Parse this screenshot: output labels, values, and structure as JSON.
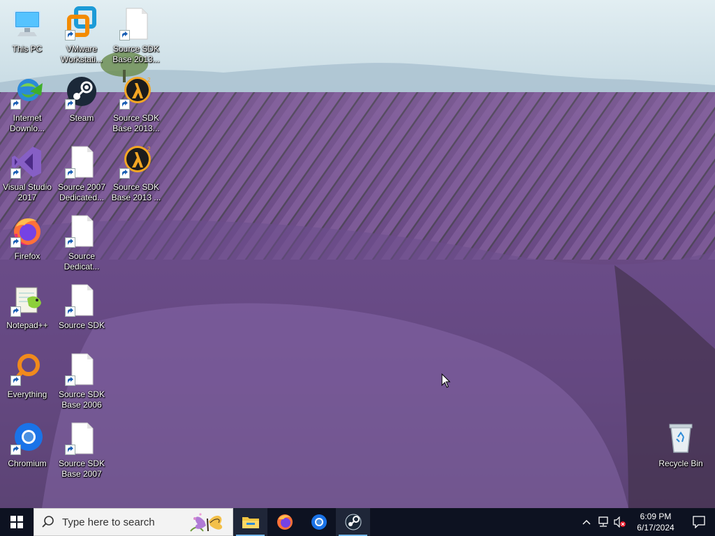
{
  "desktop": {
    "icons_left": [
      {
        "id": "this-pc",
        "label": "This PC",
        "icon": "this-pc-icon",
        "shortcut": false
      },
      {
        "id": "internet-download-manager",
        "label": "Internet\nDownlo...",
        "icon": "internet-download-manager-icon",
        "shortcut": true
      },
      {
        "id": "visual-studio-2017",
        "label": "Visual Studio\n2017",
        "icon": "visual-studio-icon",
        "shortcut": true
      },
      {
        "id": "firefox",
        "label": "Firefox",
        "icon": "firefox-icon",
        "shortcut": true
      },
      {
        "id": "notepad-plus-plus",
        "label": "Notepad++",
        "icon": "notepad-plus-plus-icon",
        "shortcut": true
      },
      {
        "id": "everything",
        "label": "Everything",
        "icon": "everything-icon",
        "shortcut": true
      },
      {
        "id": "chromium",
        "label": "Chromium",
        "icon": "chromium-icon",
        "shortcut": true
      }
    ],
    "icons_middle": [
      {
        "id": "vmware-workstation",
        "label": "VMware\nWorkstati...",
        "icon": "vmware-icon",
        "shortcut": true
      },
      {
        "id": "steam",
        "label": "Steam",
        "icon": "steam-icon",
        "shortcut": true
      },
      {
        "id": "source-2007-dedicated",
        "label": "Source 2007\nDedicated...",
        "icon": "blank-file-icon",
        "shortcut": true
      },
      {
        "id": "source-dedicated",
        "label": "Source\nDedicat...",
        "icon": "blank-file-icon",
        "shortcut": true
      },
      {
        "id": "source-sdk",
        "label": "Source SDK",
        "icon": "blank-file-icon",
        "shortcut": true
      },
      {
        "id": "source-sdk-base-2006",
        "label": "Source SDK\nBase 2006",
        "icon": "blank-file-icon",
        "shortcut": true
      },
      {
        "id": "source-sdk-base-2007",
        "label": "Source SDK\nBase 2007",
        "icon": "blank-file-icon",
        "shortcut": true
      }
    ],
    "icons_right": [
      {
        "id": "source-sdk-base-2013-a",
        "label": "Source SDK\nBase 2013...",
        "icon": "blank-file-icon",
        "shortcut": true
      },
      {
        "id": "source-sdk-base-2013-b",
        "label": "Source SDK\nBase 2013...",
        "icon": "half-life-2-icon",
        "shortcut": true
      },
      {
        "id": "source-sdk-base-2013-c",
        "label": "Source SDK\nBase 2013 ...",
        "icon": "half-life-2-icon",
        "shortcut": true
      }
    ],
    "recycle_bin": {
      "label": "Recycle Bin",
      "icon": "recycle-bin-icon"
    }
  },
  "taskbar": {
    "search_placeholder": "Type here to search",
    "apps": [
      {
        "id": "file-explorer",
        "icon": "file-explorer-icon",
        "active": true
      },
      {
        "id": "firefox",
        "icon": "firefox-icon",
        "active": false
      },
      {
        "id": "chromium",
        "icon": "chromium-icon",
        "active": false
      },
      {
        "id": "steam",
        "icon": "steam-icon",
        "active": true
      }
    ],
    "tray": {
      "time": "6:09 PM",
      "date": "6/17/2024",
      "icons": [
        "chevron-up-icon",
        "network-icon",
        "volume-muted-icon"
      ]
    }
  },
  "colors": {
    "taskbar_bg": "#0d1221",
    "search_bg": "#f3f3f3",
    "active_indicator": "#76b9ed",
    "label_text": "#ffffff"
  }
}
